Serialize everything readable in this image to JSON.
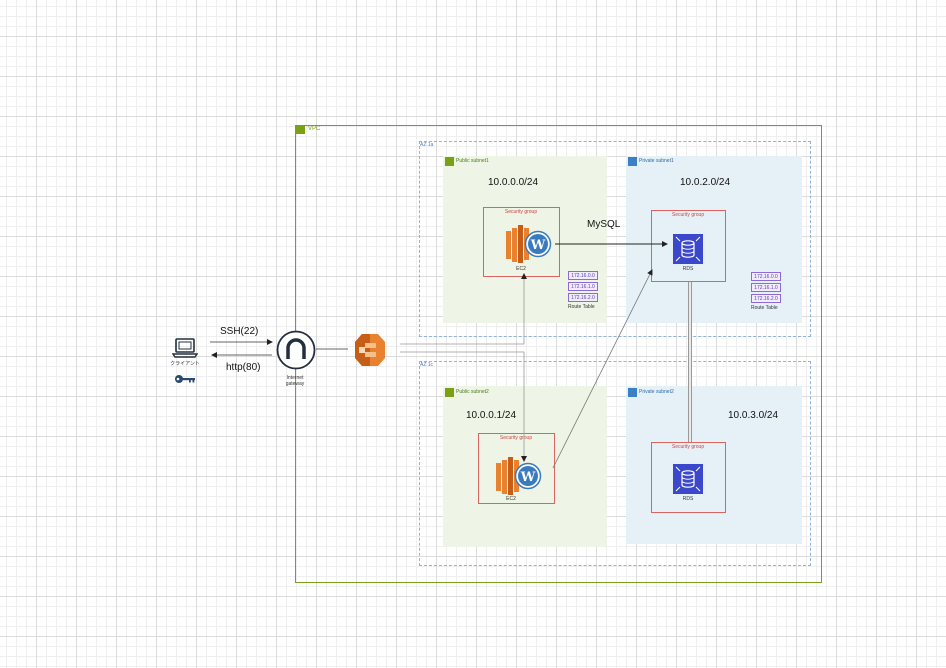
{
  "vpc": {
    "label": "VPC"
  },
  "az": [
    {
      "label": "AZ 1a"
    },
    {
      "label": "AZ 1c"
    }
  ],
  "subnets": [
    {
      "label": "Public subnet1",
      "cidr": "10.0.0.0/24"
    },
    {
      "label": "Private subnet1",
      "cidr": "10.0.2.0/24"
    },
    {
      "label": "Public subnet2",
      "cidr": "10.0.0.1/24"
    },
    {
      "label": "Private subnet2",
      "cidr": "10.0.3.0/24"
    }
  ],
  "security_group": {
    "label": "Security group"
  },
  "services": {
    "ec2": "EC2",
    "rds": "RDS"
  },
  "client": {
    "label": "クライアント"
  },
  "igw": {
    "line1": "Internet",
    "line2": "gateway"
  },
  "edges": {
    "ssh": "SSH(22)",
    "http": "http(80)",
    "mysql": "MySQL"
  },
  "route_table": {
    "label": "Route Table",
    "rows": [
      "172.16.0.0",
      "172.16.1.0",
      "172.16.2.0"
    ]
  },
  "colors": {
    "vpc": "#7aa116",
    "public": "#7aa116",
    "private": "#3b7fc4",
    "sg": "#d8655f",
    "ec2": "#e8822e",
    "rds": "#3b48cc"
  }
}
